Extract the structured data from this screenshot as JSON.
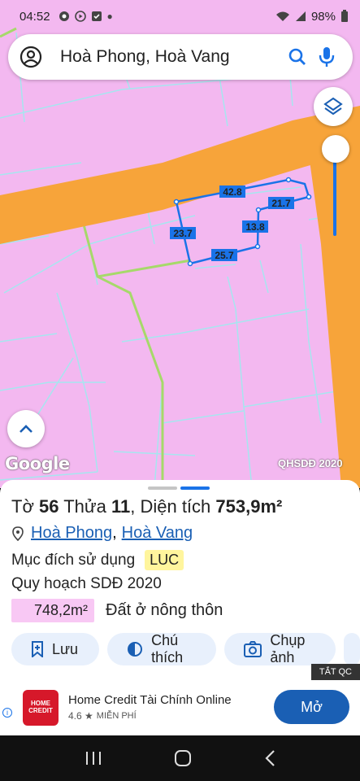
{
  "status": {
    "time": "04:52",
    "battery": "98%"
  },
  "search": {
    "query": "Hoà Phong, Hoà Vang"
  },
  "map": {
    "measurements": [
      "42.8",
      "21.7",
      "13.8",
      "23.7",
      "25.7"
    ],
    "attribution": "Google",
    "layer_label": "QHSDĐ 2020"
  },
  "parcel": {
    "title_prefix": "Tờ",
    "sheet": "56",
    "parcel_label": "Thửa",
    "parcel": "11",
    "area_label": ", Diện tích",
    "area": "753,9m²",
    "ward": "Hoà Phong",
    "district": "Hoà Vang",
    "separator": ",",
    "purpose_label": "Mục đích sử dụng",
    "purpose_code": "LUC",
    "plan_label": "Quy hoạch SDĐ 2020",
    "plan_area": "748,2m²",
    "plan_type": "Đất ở nông thôn"
  },
  "actions": {
    "save": "Lưu",
    "note": "Chú thích",
    "capture": "Chụp ảnh"
  },
  "ad": {
    "close": "TẮT QC",
    "logo_text": "HOME CREDIT",
    "title": "Home Credit Tài Chính Online",
    "rating": "4.6 ★",
    "price": "MIỄN PHÍ",
    "cta": "Mở"
  },
  "colors": {
    "parcel_fill": "#f3b8f0",
    "road": "#f7a43a",
    "boundary": "#1a73e8",
    "accent": "#1a5fb4"
  }
}
